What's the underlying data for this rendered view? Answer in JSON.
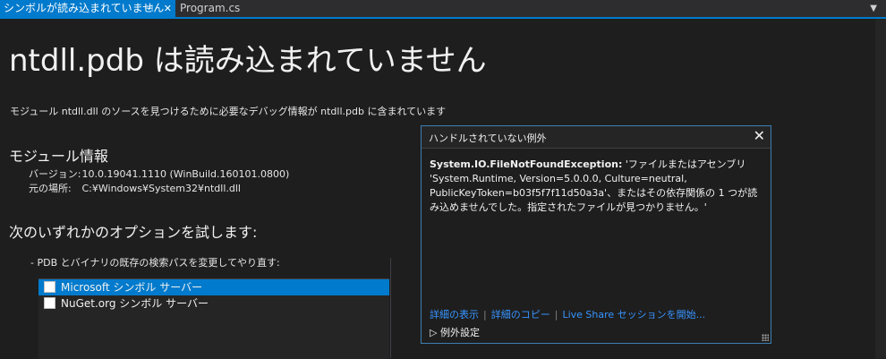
{
  "tabs": {
    "active": "シンボルが読み込まれていません",
    "active_pin": "⊣",
    "active_close": "✕",
    "inactive": "Program.cs",
    "dropdown": "▼"
  },
  "page": {
    "title": "ntdll.pdb は読み込まれていません",
    "subtitle": "モジュール ntdll.dll のソースを見つけるために必要なデバッグ情報が ntdll.pdb に含まれています",
    "module_section": "モジュール情報",
    "version_label": "バージョン:",
    "version_value": "10.0.19041.1110 (WinBuild.160101.0800)",
    "location_label": "元の場所:",
    "location_value": "C:¥Windows¥System32¥ntdll.dll",
    "options_section": "次のいずれかのオプションを試します:",
    "bullet": "-  PDB とバイナリの既存の検索パスを変更してやり直す:",
    "symbol_servers": [
      "Microsoft シンボル サーバー",
      "NuGet.org シンボル サーバー"
    ]
  },
  "popup": {
    "title": "ハンドルされていない例外",
    "close": "✕",
    "exception_type": "System.IO.FileNotFoundException:",
    "message": " 'ファイルまたはアセンブリ 'System.Runtime, Version=5.0.0.0, Culture=neutral, PublicKeyToken=b03f5f7f11d50a3a'、またはその依存関係の 1 つが読み込めませんでした。指定されたファイルが見つかりません。'",
    "link_details": "詳細の表示",
    "link_copy": "詳細のコピー",
    "link_liveshare": "Live Share セッションを開始...",
    "settings": "例外設定",
    "settings_arrow": "▷"
  }
}
